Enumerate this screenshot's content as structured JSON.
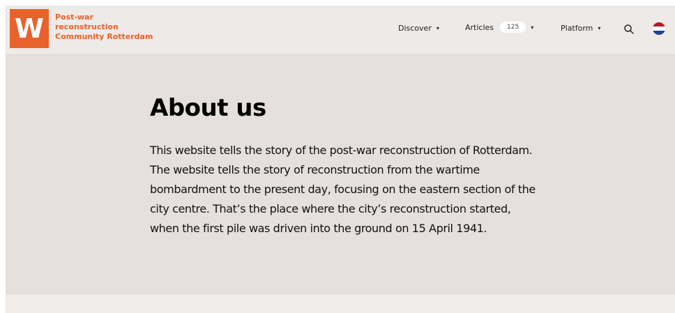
{
  "brand": {
    "logo_letter": "W",
    "title_lines": [
      "Post-war",
      "reconstruction",
      "Community Rotterdam"
    ],
    "accent_color": "#e8622b"
  },
  "nav": {
    "discover": "Discover",
    "articles": "Articles",
    "articles_count": "125",
    "platform": "Platform",
    "search_icon": "search-icon",
    "language_icon": "dutch-flag-icon"
  },
  "main": {
    "title": "About us",
    "intro": "This website tells the story of the post-war reconstruction of Rotterdam. The website tells the story of reconstruction from the wartime bombardment to the present day, focusing on the eastern section of the city centre. That’s the place where the city’s reconstruction started, when the first pile was driven into the ground on 15 April 1941."
  },
  "colors": {
    "header_bg": "#eeeae7",
    "main_bg": "#e5e0dd",
    "text": "#111111"
  }
}
